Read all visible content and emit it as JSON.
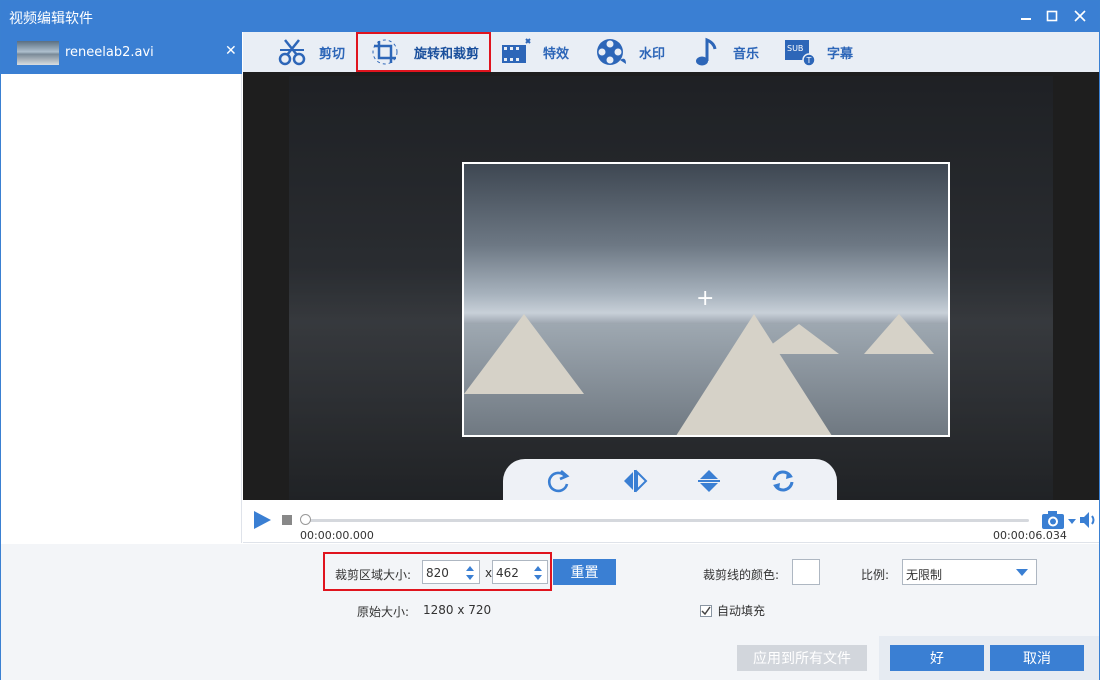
{
  "window": {
    "title": "视频编辑软件"
  },
  "file_list": [
    {
      "name": "reneelab2.avi"
    }
  ],
  "toolbar": {
    "tools": [
      {
        "label": "剪切",
        "icon": "scissors-icon"
      },
      {
        "label": "旋转和裁剪",
        "icon": "crop-rotate-icon",
        "active": true
      },
      {
        "label": "特效",
        "icon": "film-effects-icon"
      },
      {
        "label": "水印",
        "icon": "film-reel-icon"
      },
      {
        "label": "音乐",
        "icon": "music-note-icon"
      },
      {
        "label": "字幕",
        "icon": "subtitle-icon"
      }
    ]
  },
  "player": {
    "time_start": "00:00:00.000",
    "time_end": "00:00:06.034",
    "progress": 0
  },
  "crop_panel": {
    "crop_size_label": "裁剪区域大小:",
    "width": "820",
    "separator": "x",
    "height": "462",
    "reset_label": "重置",
    "original_size_label": "原始大小:",
    "original_size_value": "1280 x 720",
    "line_color_label": "裁剪线的颜色:",
    "line_color": "#ffffff",
    "ratio_label": "比例:",
    "ratio_value": "无限制",
    "autofill_label": "自动填充",
    "autofill_checked": true
  },
  "footer": {
    "apply_all_label": "应用到所有文件",
    "ok_label": "好",
    "cancel_label": "取消"
  },
  "colors": {
    "accent": "#3a7fd3",
    "highlight_border": "#e0141e"
  }
}
